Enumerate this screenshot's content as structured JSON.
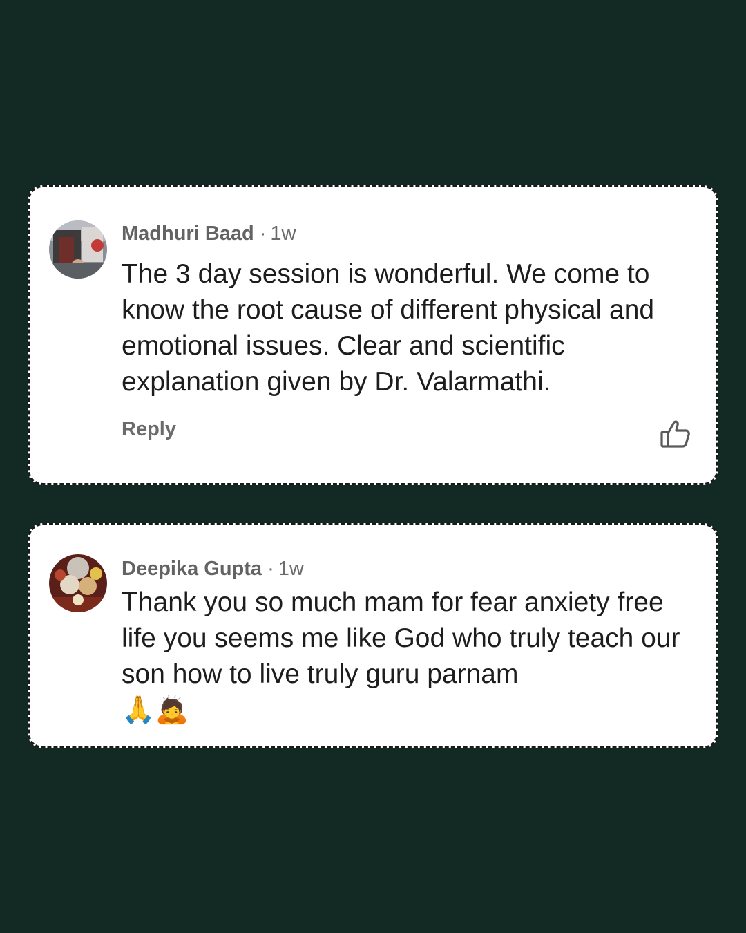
{
  "comments": [
    {
      "author": "Madhuri Baad",
      "separator": "·",
      "time": "1w",
      "text": "The 3 day session is wonderful. We come to know the root cause of different  physical and emotional issues. Clear and scientific explanation given by Dr. Valarmathi.",
      "reply_label": "Reply",
      "avatar_icon": "photo-avatar",
      "like_icon": "thumbs-up-icon"
    },
    {
      "author": "Deepika Gupta",
      "separator": "·",
      "time": "1w",
      "text": "Thank you so much mam for fear anxiety free life you seems me like God who truly teach our son how to live truly guru parnam",
      "emoji": "🙏🙇",
      "avatar_icon": "photo-avatar"
    }
  ]
}
